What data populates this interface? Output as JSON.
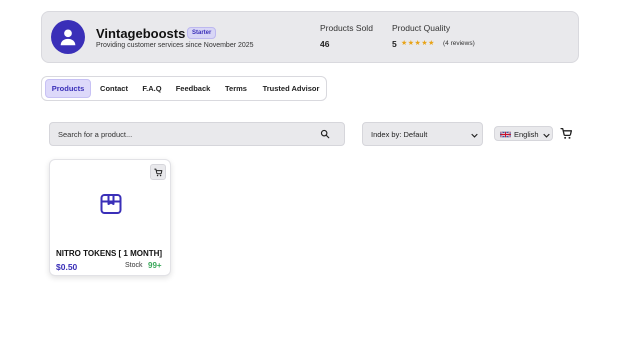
{
  "colors": {
    "accent": "#3a2fb8",
    "accent_light": "#ddd9fa",
    "stock_green": "#3aa85a",
    "star": "#e8a317"
  },
  "header": {
    "avatar_icon": "user-icon",
    "shop_name": "Vintageboosts",
    "badge": "Starter",
    "tagline": "Providing customer services since November 2025",
    "products_sold_label": "Products Sold",
    "products_sold_value": "46",
    "quality_label": "Product Quality",
    "quality_value": "5",
    "stars": "★★★★★",
    "reviews": "(4 reviews)"
  },
  "nav": {
    "tabs": [
      {
        "label": "Products",
        "active": true
      },
      {
        "label": "Contact",
        "active": false
      },
      {
        "label": "F.A.Q",
        "active": false
      },
      {
        "label": "Feedback",
        "active": false
      },
      {
        "label": "Terms",
        "active": false
      },
      {
        "label": "Trusted Advisor",
        "active": false
      }
    ]
  },
  "toolbar": {
    "search_placeholder": "Search for a product...",
    "search_icon": "search-icon",
    "sort_label": "Index by: Default",
    "language_label": "English",
    "language_flag": "uk-flag-icon",
    "cart_icon": "cart-icon"
  },
  "products": [
    {
      "name": "NITRO TOKENS [ 1 MONTH]",
      "price": "$0.50",
      "stock_label": "Stock",
      "stock_value": "99+",
      "icon": "package-icon"
    }
  ]
}
